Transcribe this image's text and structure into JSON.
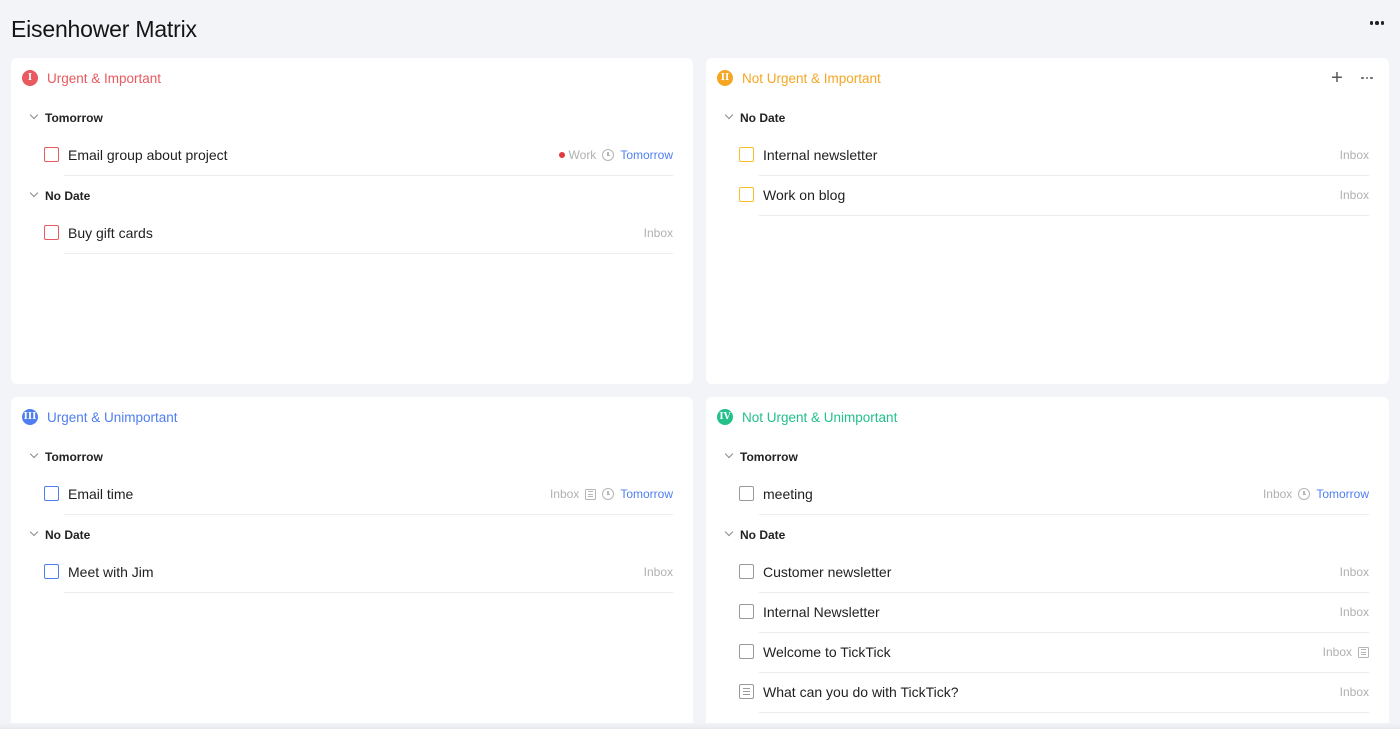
{
  "page": {
    "title": "Eisenhower Matrix"
  },
  "colors": {
    "red": "#e85a5f",
    "yellow": "#f5a623",
    "blue": "#4f7ef0",
    "green": "#23c08a",
    "date_blue": "#4f7ef0"
  },
  "quadrants": [
    {
      "badge": "I",
      "title": "Urgent & Important",
      "groups": [
        {
          "label": "Tomorrow",
          "tasks": [
            {
              "title": "Email group about project",
              "meta": {
                "list": "Work",
                "date": "Tomorrow"
              }
            }
          ]
        },
        {
          "label": "No Date",
          "tasks": [
            {
              "title": "Buy gift cards",
              "meta": {
                "list": "Inbox"
              }
            }
          ]
        }
      ]
    },
    {
      "badge": "II",
      "title": "Not Urgent & Important",
      "groups": [
        {
          "label": "No Date",
          "tasks": [
            {
              "title": "Internal newsletter",
              "meta": {
                "list": "Inbox"
              }
            },
            {
              "title": "Work on blog",
              "meta": {
                "list": "Inbox"
              }
            }
          ]
        }
      ]
    },
    {
      "badge": "III",
      "title": "Urgent & Unimportant",
      "groups": [
        {
          "label": "Tomorrow",
          "tasks": [
            {
              "title": "Email time",
              "meta": {
                "list": "Inbox",
                "date": "Tomorrow"
              }
            }
          ]
        },
        {
          "label": "No Date",
          "tasks": [
            {
              "title": "Meet with Jim",
              "meta": {
                "list": "Inbox"
              }
            }
          ]
        }
      ]
    },
    {
      "badge": "IV",
      "title": "Not Urgent & Unimportant",
      "groups": [
        {
          "label": "Tomorrow",
          "tasks": [
            {
              "title": "meeting",
              "meta": {
                "list": "Inbox",
                "date": "Tomorrow"
              }
            }
          ]
        },
        {
          "label": "No Date",
          "tasks": [
            {
              "title": "Customer newsletter",
              "meta": {
                "list": "Inbox"
              }
            },
            {
              "title": "Internal Newsletter",
              "meta": {
                "list": "Inbox"
              }
            },
            {
              "title": "Welcome to TickTick",
              "meta": {
                "list": "Inbox"
              }
            },
            {
              "title": "What can you do with TickTick?",
              "meta": {
                "list": "Inbox"
              }
            }
          ]
        }
      ]
    }
  ]
}
